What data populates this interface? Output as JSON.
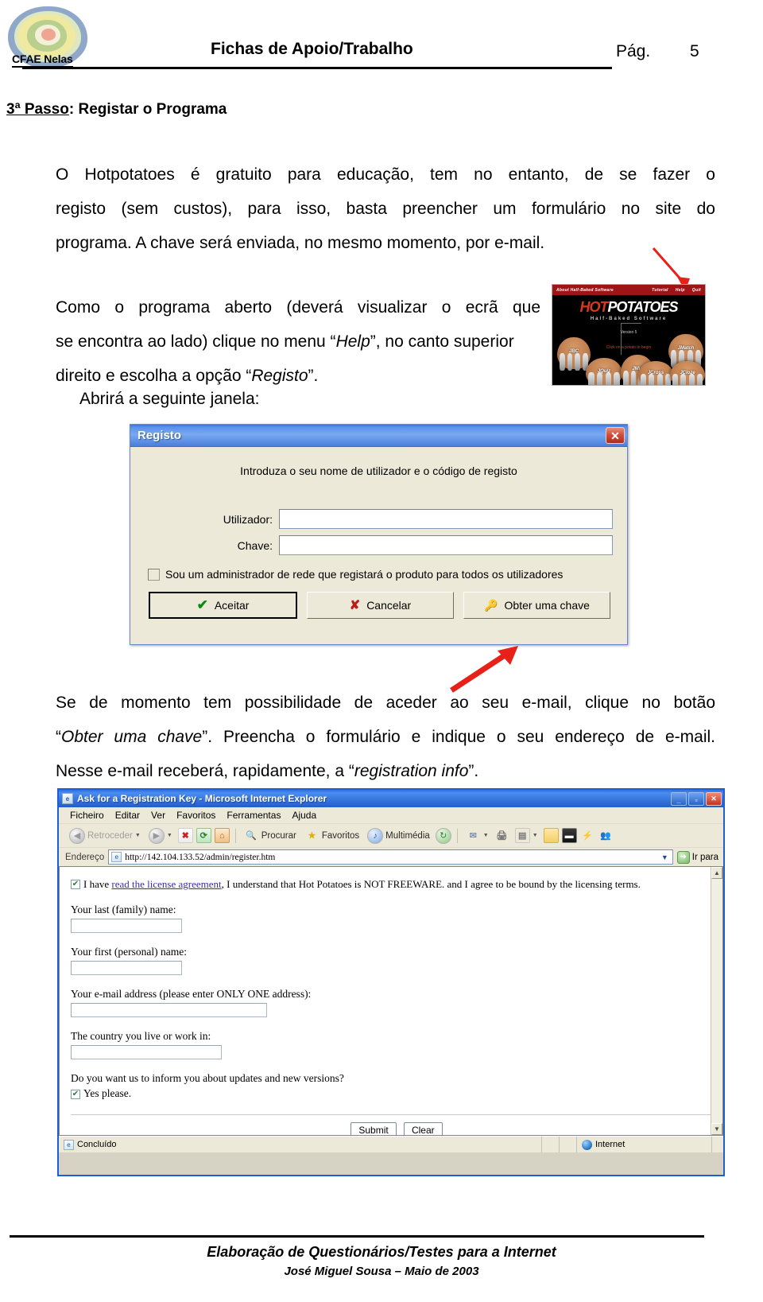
{
  "header": {
    "logo_label": "CFAE Nelas",
    "title": "Fichas de Apoio/Trabalho",
    "page_label": "Pág.",
    "page_number": "5"
  },
  "step": {
    "number_label": "3ª Passo",
    "separator": ":",
    "title": "Registar o Programa"
  },
  "paragraphs": {
    "p1_line1": "O  Hotpotatoes  é  gratuito  para  educação,  tem  no  entanto,  de  se  fazer  o",
    "p1_line2": "registo  (sem  custos),  para  isso,  basta  preencher  um  formulário  no  site  do",
    "p1_line3": "programa. A chave será enviada, no mesmo momento, por e-mail.",
    "p2_line1": "Como  o  programa  aberto  (deverá  visualizar  o  ecrã  que",
    "p2_line2_a": "se encontra ao lado) clique no menu “",
    "p2_line2_em": "Help",
    "p2_line2_b": "”, no canto superior",
    "p2_line3_a": "direito e escolha a opção “",
    "p2_line3_em": "Registo",
    "p2_line3_b": "”.",
    "p_abrira": "Abrirá a seguinte janela:",
    "p3_line1_a": "Se de momento tem possibilidade de aceder ao seu e-mail, clique no botão",
    "p3_line2_em": "Obter uma chave",
    "p3_line2_a": "“",
    "p3_line2_b": "”.  Preencha  o  formulário  e  indique  o  seu  endereço  de  e-mail.",
    "p3_line3_a": "Nesse e-mail receberá, rapidamente, a “",
    "p3_line3_em": "registration info",
    "p3_line3_b": "”."
  },
  "hotpotatoes_splash": {
    "menu_left": "About Half-Baked Software",
    "menu_tutorial": "Tutorial",
    "menu_help": "Help",
    "menu_quit": "Quit",
    "logo_hot": "HOT",
    "logo_potatoes": "POTATOES",
    "tagline": "Half-Baked Software",
    "version": "Version 5",
    "hint": "Click on a potato to begin",
    "potato_labels": [
      "JBC",
      "JMatch",
      "JQuiz",
      "JMix",
      "JCross",
      "JCloze"
    ]
  },
  "registo_dialog": {
    "title": "Registo",
    "close_icon": "close-icon",
    "prompt": "Introduza o seu nome de utilizador e o código de registo",
    "fields": [
      {
        "label": "Utilizador:",
        "value": ""
      },
      {
        "label": "Chave:",
        "value": ""
      }
    ],
    "checkbox_label": "Sou um administrador de rede que registará o produto para todos os utilizadores",
    "checkbox_checked": false,
    "buttons": [
      {
        "label": "Aceitar",
        "icon": "check-icon",
        "accel": "t"
      },
      {
        "label": "Cancelar",
        "icon": "x-icon",
        "accel": "C"
      },
      {
        "label": "Obter uma chave",
        "icon": "key-icon",
        "accel": "O"
      }
    ]
  },
  "ie_window": {
    "title": "Ask for a Registration Key - Microsoft Internet Explorer",
    "window_buttons": [
      "minimize",
      "maximize",
      "close"
    ],
    "menus": [
      "Ficheiro",
      "Editar",
      "Ver",
      "Favoritos",
      "Ferramentas",
      "Ajuda"
    ],
    "toolbar": [
      {
        "name": "back",
        "label": "Retroceder",
        "icon": "back-arrow-icon"
      },
      {
        "name": "forward",
        "label": "",
        "icon": "forward-arrow-icon"
      },
      {
        "name": "stop",
        "label": "",
        "icon": "stop-icon"
      },
      {
        "name": "refresh",
        "label": "",
        "icon": "refresh-icon"
      },
      {
        "name": "home",
        "label": "",
        "icon": "home-icon"
      },
      {
        "name": "search",
        "label": "Procurar",
        "icon": "search-icon"
      },
      {
        "name": "favorites",
        "label": "Favoritos",
        "icon": "star-icon"
      },
      {
        "name": "media",
        "label": "Multimédia",
        "icon": "media-icon"
      },
      {
        "name": "history",
        "label": "",
        "icon": "history-icon"
      },
      {
        "name": "mail",
        "label": "",
        "icon": "mail-icon"
      },
      {
        "name": "print",
        "label": "",
        "icon": "print-icon"
      },
      {
        "name": "edit",
        "label": "",
        "icon": "edit-icon"
      },
      {
        "name": "folder",
        "label": "",
        "icon": "folder-icon"
      },
      {
        "name": "fullscreen",
        "label": "",
        "icon": "fullscreen-icon"
      },
      {
        "name": "messenger",
        "label": "",
        "icon": "messenger-icon"
      },
      {
        "name": "people",
        "label": "",
        "icon": "people-icon"
      }
    ],
    "address": {
      "label": "Endereço",
      "url": "http://142.104.133.52/admin/register.htm",
      "go_label": "Ir para"
    },
    "status": {
      "text": "Concluído",
      "zone": "Internet"
    }
  },
  "register_form": {
    "license_prefix": "I have ",
    "license_link": "read the license agreement",
    "license_suffix": ", I understand that Hot Potatoes is NOT FREEWARE. and I agree to be bound by the licensing terms.",
    "license_checked": true,
    "fields": [
      {
        "label": "Your last (family) name:",
        "value": "",
        "width": "fi-w1"
      },
      {
        "label": "Your first (personal) name:",
        "value": "",
        "width": "fi-w1"
      },
      {
        "label": "Your e-mail address (please enter ONLY ONE address):",
        "value": "",
        "width": "fi-w2"
      },
      {
        "label": "The country you live or work in:",
        "value": "",
        "width": "fi-w3"
      }
    ],
    "updates_question": "Do you want us to inform you about updates and new versions?",
    "updates_option": "Yes please.",
    "updates_checked": true,
    "submit_label": "Submit",
    "clear_label": "Clear"
  },
  "footer": {
    "line1": "Elaboração de Questionários/Testes para a Internet",
    "line2": "José Miguel Sousa – Maio de 2003"
  },
  "colors": {
    "title_bar_blue": "#4b8cf0",
    "accent_red": "#d22b12",
    "dialog_face": "#ece9d8",
    "link_blue": "#3a2fa8"
  }
}
